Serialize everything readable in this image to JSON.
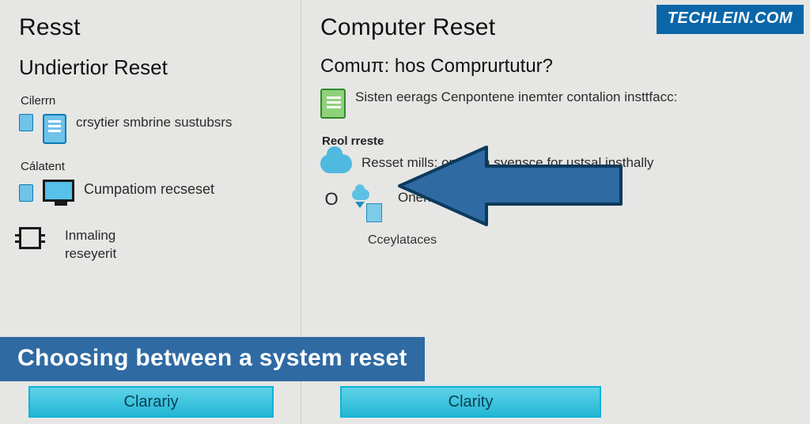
{
  "brand": "TECHLEIN.COM",
  "caption": "Choosing between a system reset",
  "left": {
    "title": "Resst",
    "heading": "Undiertior Reset",
    "label1": "Cilerrn",
    "item1": "crsytier smbrine sustubsrs",
    "label2": "Cálatent",
    "item2": "Cumpatiom recseset",
    "item3a": "Inmaling",
    "item3b": "reseyerit",
    "button": "Clarariy"
  },
  "right": {
    "title": "Computer Reset",
    "heading": "Comuπ: hos Comprurtutur?",
    "item1": "Sisten eerags Cenpontene inemter contalion insttfacc:",
    "label_reol": "Reol rreste",
    "item2": "Resset mills:   onal orn syensce for ustsal insthally",
    "item3": "Onenen ac ustfcelifictnioms",
    "footer": "Cceylataces",
    "button": "Clarity"
  }
}
